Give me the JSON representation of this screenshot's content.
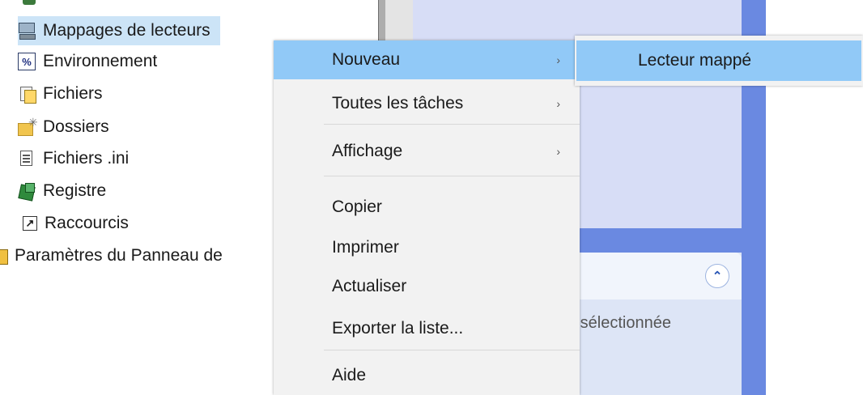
{
  "tree": {
    "items": [
      {
        "label": "Mappages de lecteurs",
        "icon": "drive-map-icon"
      },
      {
        "label": "Environnement",
        "icon": "environment-icon"
      },
      {
        "label": "Fichiers",
        "icon": "files-icon"
      },
      {
        "label": "Dossiers",
        "icon": "folder-icon"
      },
      {
        "label": "Fichiers .ini",
        "icon": "ini-file-icon"
      },
      {
        "label": "Registre",
        "icon": "registry-icon"
      },
      {
        "label": "Raccourcis",
        "icon": "shortcut-icon"
      },
      {
        "label": "Paramètres du Panneau de",
        "icon": "control-panel-icon"
      }
    ],
    "selected_index": 0
  },
  "context_menu": {
    "items": [
      {
        "label": "Nouveau",
        "submenu": true,
        "highlighted": true
      },
      {
        "label": "Toutes les tâches",
        "submenu": true
      },
      {
        "label": "Affichage",
        "submenu": true
      },
      {
        "label": "Copier"
      },
      {
        "label": "Imprimer"
      },
      {
        "label": "Actualiser"
      },
      {
        "label": "Exporter la liste..."
      },
      {
        "label": "Aide"
      }
    ],
    "arrow_glyph": "›"
  },
  "submenu": {
    "items": [
      {
        "label": "Lecteur mappé",
        "highlighted": true
      }
    ]
  },
  "background_panel": {
    "text": "e sélectionnée",
    "collapse_glyph": "⌃"
  },
  "colors": {
    "highlight": "#91c9f7",
    "selection": "#cce4f7",
    "menu_bg": "#f2f2f2",
    "task_blue": "#6a89e1",
    "task_light": "#d7ddf6"
  }
}
